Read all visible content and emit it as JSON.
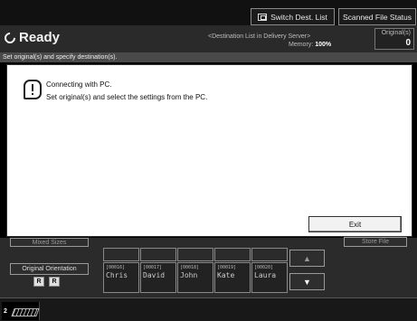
{
  "header": {
    "switch_dest_list": "Switch Dest. List",
    "scanned_file_status": "Scanned File Status"
  },
  "status": {
    "ready": "Ready",
    "dest_list": "<Destination List in Delivery Server>",
    "memory_label": "Memory:",
    "memory_value": "100%",
    "originals_label": "Original(s)",
    "originals_count": "0"
  },
  "instruction": "Set original(s) and specify destination(s).",
  "dialog": {
    "line1": "Connecting with PC.",
    "line2": "Set original(s) and select the settings from the PC.",
    "exit_label": "Exit"
  },
  "panel": {
    "mixed_sizes": "Mixed Sizes",
    "original_orientation": "Original Orientation",
    "orient_a1": "R",
    "orient_a2": "R",
    "store_file": "Store File",
    "destinations": [
      {
        "code": "[00016]",
        "name": "Chris"
      },
      {
        "code": "[00017]",
        "name": "David"
      },
      {
        "code": "[00018]",
        "name": "John"
      },
      {
        "code": "[00019]",
        "name": "Kate"
      },
      {
        "code": "[00020]",
        "name": "Laura"
      }
    ]
  },
  "footer": {
    "sig_label": "2"
  }
}
